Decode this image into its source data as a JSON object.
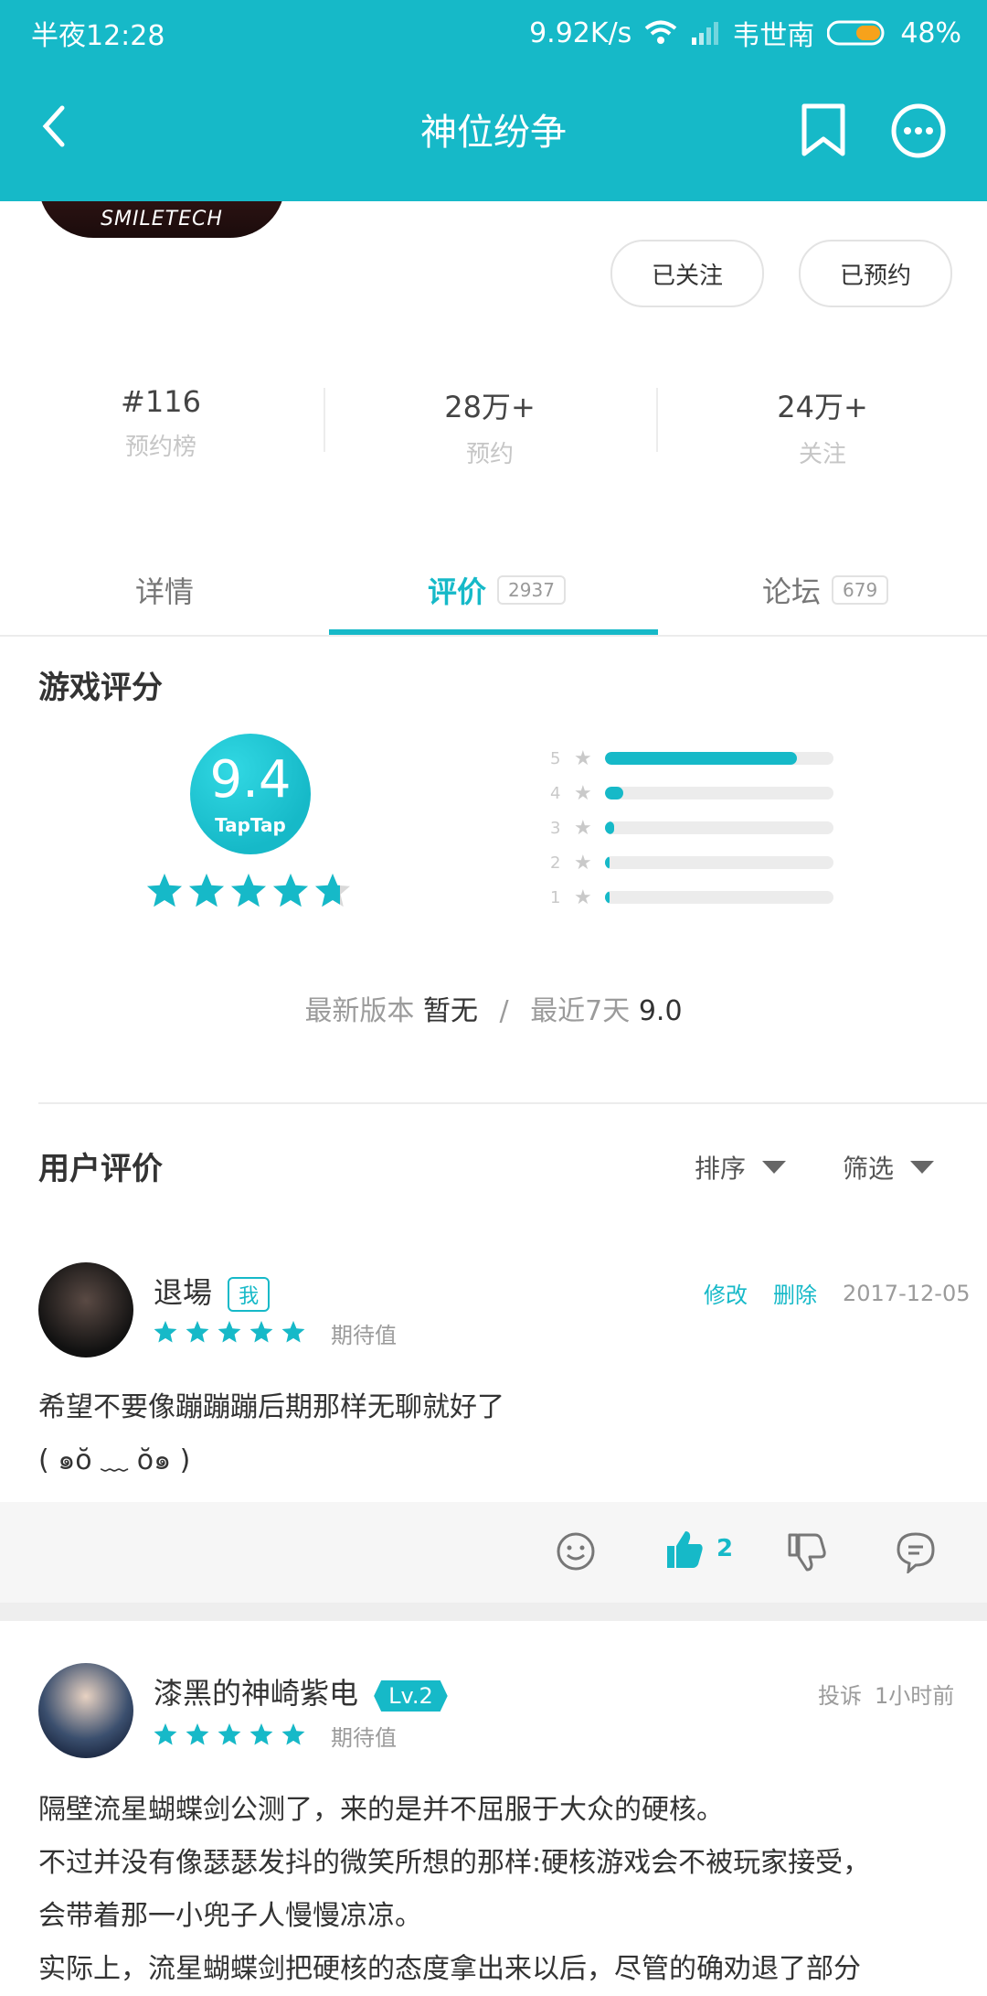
{
  "status_bar": {
    "time": "半夜12:28",
    "net_speed": "9.92K/s",
    "carrier": "韦世南",
    "battery": "48%"
  },
  "app_bar": {
    "title": "神位纷争",
    "back_icon": "back-arrow-icon",
    "bookmark_icon": "bookmark-icon",
    "more_icon": "more-icon"
  },
  "game": {
    "icon_text": "SMILETECH",
    "followed_label": "已关注",
    "reserved_label": "已预约"
  },
  "stats": [
    {
      "value": "#116",
      "label": "预约榜"
    },
    {
      "value": "28万+",
      "label": "预约"
    },
    {
      "value": "24万+",
      "label": "关注"
    }
  ],
  "tabs": [
    {
      "label": "详情",
      "count": ""
    },
    {
      "label": "评价",
      "count": "2937",
      "active": true
    },
    {
      "label": "论坛",
      "count": "679"
    }
  ],
  "rating": {
    "section_title": "游戏评分",
    "score": "9.4",
    "brand": "TapTap",
    "stars": 4.7,
    "distribution": [
      {
        "stars": "5",
        "fraction": 0.84
      },
      {
        "stars": "4",
        "fraction": 0.08
      },
      {
        "stars": "3",
        "fraction": 0.04
      },
      {
        "stars": "2",
        "fraction": 0.01
      },
      {
        "stars": "1",
        "fraction": 0.01
      }
    ],
    "latest_version_label": "最新版本",
    "latest_version_value": "暂无",
    "separator": "/",
    "recent_label": "最近7天",
    "recent_value": "9.0"
  },
  "reviews_header": {
    "title": "用户评价",
    "sort_label": "排序",
    "filter_label": "筛选"
  },
  "reviews": [
    {
      "name": "退場",
      "tag": "我",
      "stars": 5,
      "subtitle": "期待值",
      "edit_label": "修改",
      "delete_label": "删除",
      "date": "2017-12-05",
      "lines": [
        "希望不要像蹦蹦蹦后期那样无聊就好了",
        "( ๑ŏ ﹏ ŏ๑ )"
      ],
      "likes": "2"
    },
    {
      "name": "漆黑的神崎紫电",
      "level": "Lv.2",
      "stars": 5,
      "subtitle": "期待值",
      "report_label": "投诉",
      "time": "1小时前",
      "lines": [
        "隔壁流星蝴蝶剑公测了，来的是并不屈服于大众的硬核。",
        "不过并没有像瑟瑟发抖的微笑所想的那样:硬核游戏会不被玩家接受，",
        "会带着那一小兜子人慢慢凉凉。",
        "实际上，流星蝴蝶剑把硬核的态度拿出来以后，尽管的确劝退了部分"
      ]
    }
  ],
  "colors": {
    "accent": "#16b9c8",
    "text": "#333333",
    "muted": "#9b9b9b"
  }
}
